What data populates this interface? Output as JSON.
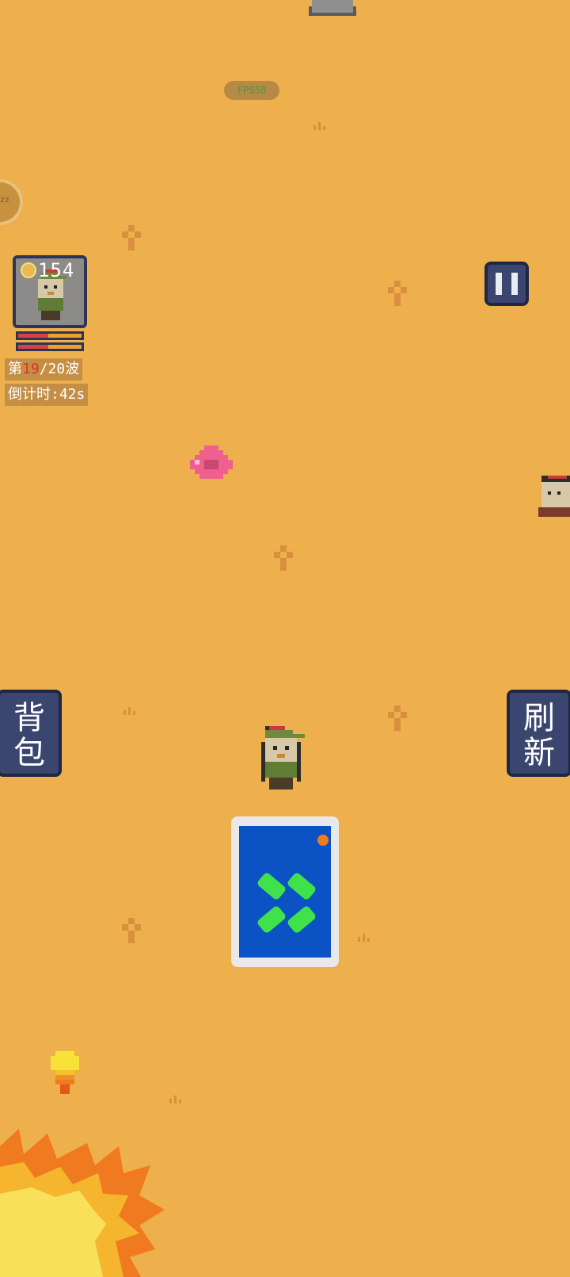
{
  "hud": {
    "fps_label": "FPS58",
    "coins": "154",
    "wave": {
      "prefix": "第",
      "current": "19",
      "suffix": "/20波"
    },
    "countdown": "倒计时:42s",
    "hp_fraction": 0.47
  },
  "buttons": {
    "backpack_line1": "背",
    "backpack_line2": "包",
    "refresh_line1": "刷",
    "refresh_line2": "新"
  },
  "sleep_badge": "zz",
  "colors": {
    "ground": "#eeb04c",
    "panel": "#3a4670",
    "card_blue": "#0b53c4",
    "pip_green": "#3fe24a",
    "heart": "#ef5f8f"
  },
  "icons": [
    "pause-icon",
    "coin-icon",
    "heart-icon",
    "card-icon"
  ]
}
